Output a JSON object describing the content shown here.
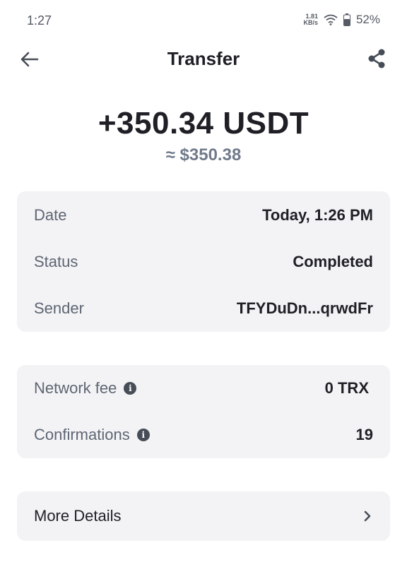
{
  "status_bar": {
    "time": "1:27",
    "net_speed_value": "1.81",
    "net_speed_unit": "KB/s",
    "battery": "52%"
  },
  "header": {
    "title": "Transfer"
  },
  "amount": {
    "crypto": "+350.34 USDT",
    "fiat": "≈ $350.38"
  },
  "details": [
    {
      "label": "Date",
      "value": "Today, 1:26 PM"
    },
    {
      "label": "Status",
      "value": "Completed"
    },
    {
      "label": "Sender",
      "value": "TFYDuDn...qrwdFr"
    }
  ],
  "fees": [
    {
      "label": "Network fee",
      "value": "0 TRX"
    },
    {
      "label": "Confirmations",
      "value": "19"
    }
  ],
  "more": {
    "label": "More Details"
  },
  "icons": {
    "back": "arrow-left-icon",
    "share": "share-icon",
    "info": "info-icon",
    "chevron": "chevron-right-icon",
    "wifi": "wifi-icon",
    "battery": "battery-icon"
  },
  "colors": {
    "text_primary": "#1e2026",
    "text_secondary": "#5e6673",
    "card_bg": "#f3f3f5"
  }
}
